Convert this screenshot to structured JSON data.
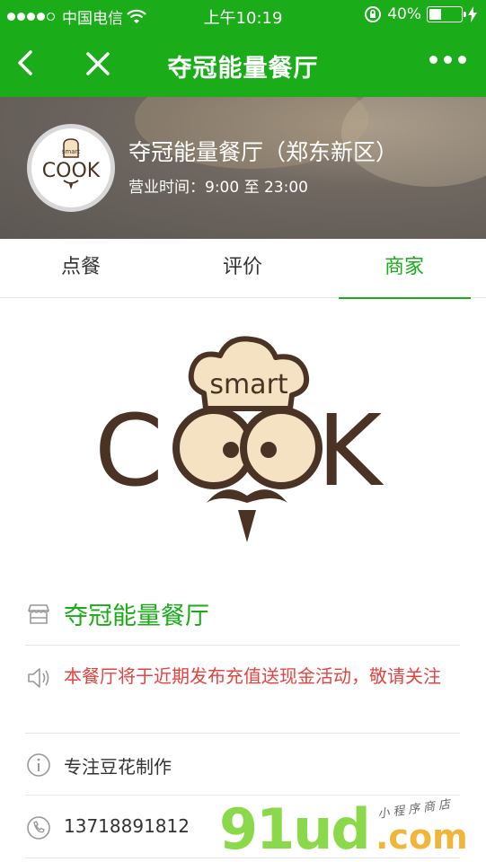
{
  "status_bar": {
    "carrier": "中国电信",
    "time": "上午10:19",
    "battery": "40%",
    "battery_level": 0.4
  },
  "navbar": {
    "title": "夺冠能量餐厅"
  },
  "header": {
    "shop_name": "夺冠能量餐厅（郑东新区）",
    "hours": "营业时间：9:00 至 23:00",
    "avatar_brand_top": "smart",
    "avatar_brand": "COOK"
  },
  "tabs": [
    {
      "label": "点餐",
      "active": false
    },
    {
      "label": "评价",
      "active": false
    },
    {
      "label": "商家",
      "active": true
    }
  ],
  "merchant": {
    "logo_top": "smart",
    "logo_text_c": "C",
    "logo_text_k": "K",
    "name": "夺冠能量餐厅",
    "notice": "本餐厅将于近期发布充值送现金活动，敬请关注",
    "description": "专注豆花制作",
    "phone": "13718891812"
  },
  "watermark": {
    "main": "91ud",
    "com": ".com",
    "sub": "小程序商店"
  },
  "colors": {
    "brand_green": "#1aad19",
    "notice_red": "#e64340",
    "logo_brown": "#4a3324",
    "logo_beige": "#f4e2c2"
  },
  "icons": [
    "back-icon",
    "close-icon",
    "more-icon",
    "store-icon",
    "speaker-icon",
    "info-icon",
    "phone-icon",
    "wifi-icon",
    "lock-rotation-icon",
    "charging-icon"
  ]
}
